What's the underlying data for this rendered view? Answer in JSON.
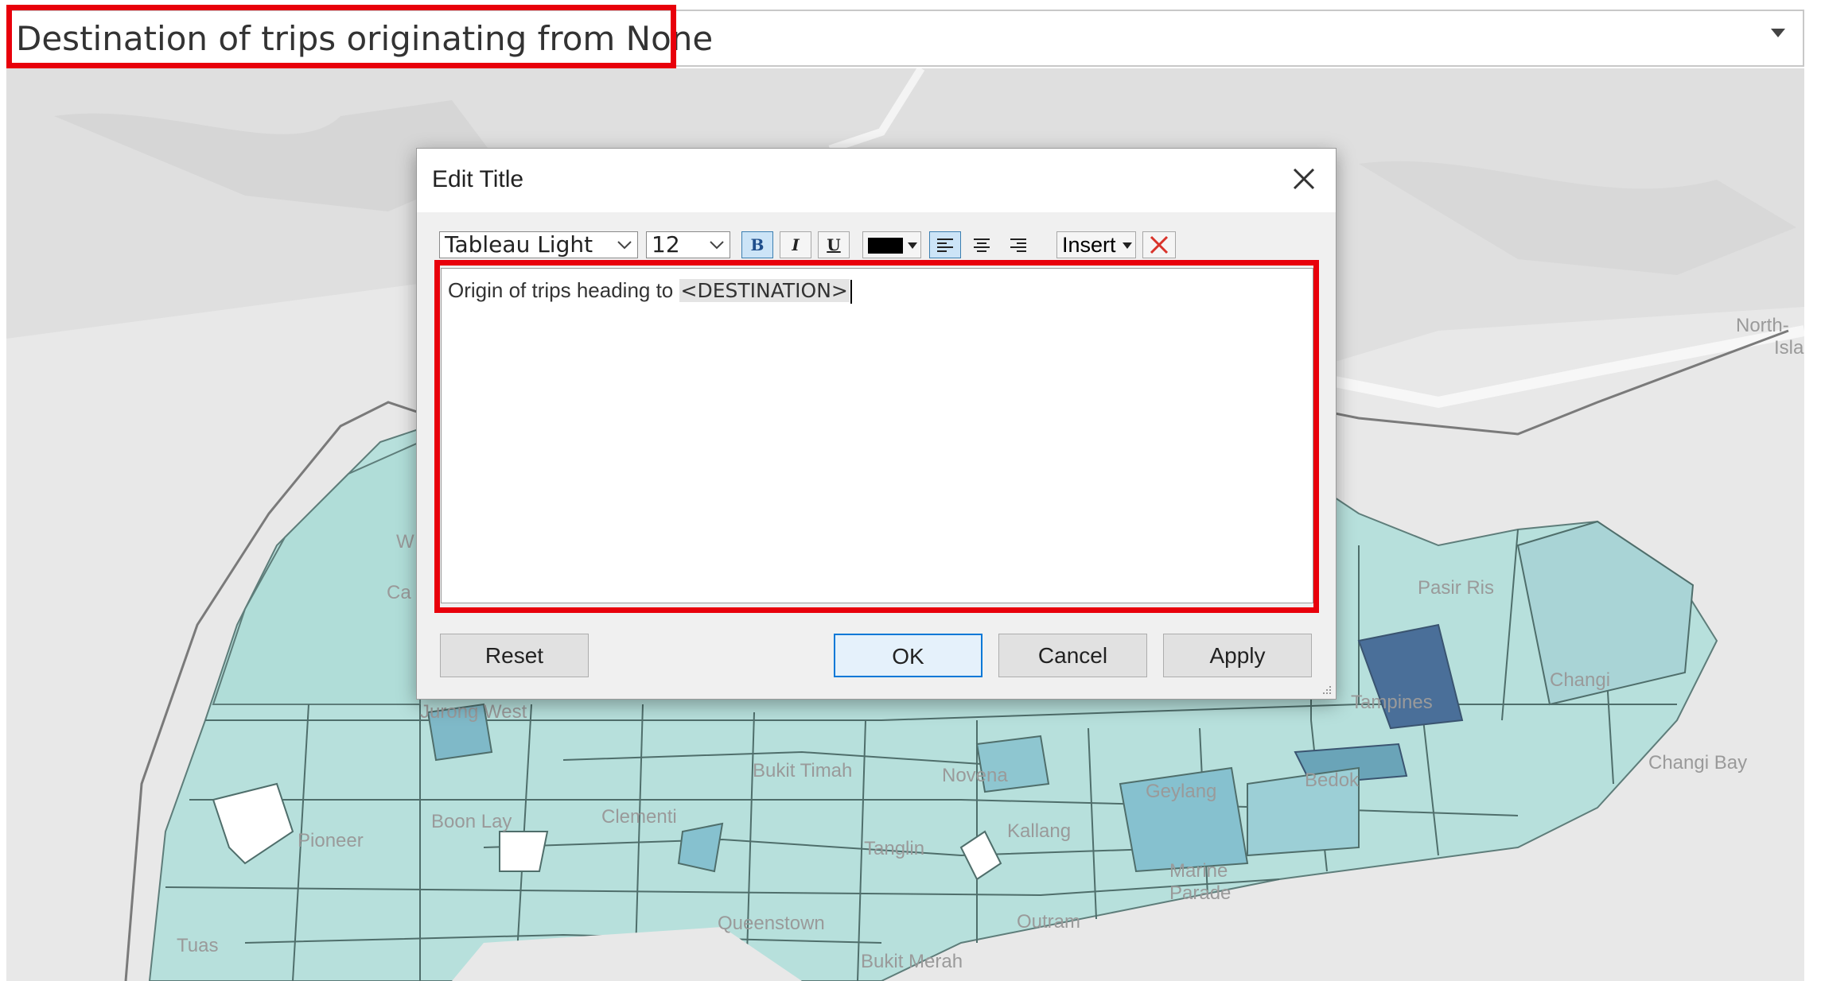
{
  "worksheet": {
    "title": "Destination of trips originating from None"
  },
  "map": {
    "labels": [
      "North-",
      "Isla",
      "Changi",
      "Changi Bay",
      "Tampines",
      "Bedok",
      "Bukit Timah",
      "Novena",
      "Geylang",
      "Kallang",
      "Marine",
      "Parade",
      "Jurong West",
      "Boon Lay",
      "Pioneer",
      "Tuas",
      "Queenstown",
      "Bukit Merah",
      "Clementi",
      "Pasir Ris",
      "Outram",
      "Tanglin",
      "W",
      "Ca"
    ]
  },
  "dialog": {
    "title": "Edit Title",
    "toolbar": {
      "font": "Tableau Light",
      "size": "12",
      "bold": "B",
      "italic": "I",
      "underline": "U",
      "insert": "Insert"
    },
    "editor": {
      "text": "Origin of trips heading to ",
      "field": "<DESTINATION>"
    },
    "buttons": {
      "reset": "Reset",
      "ok": "OK",
      "cancel": "Cancel",
      "apply": "Apply"
    }
  },
  "colors": {
    "highlight": "#e8000b",
    "region_light": "#b7e0dc",
    "region_mid": "#86c1cf",
    "region_dark": "#4a6f99"
  }
}
